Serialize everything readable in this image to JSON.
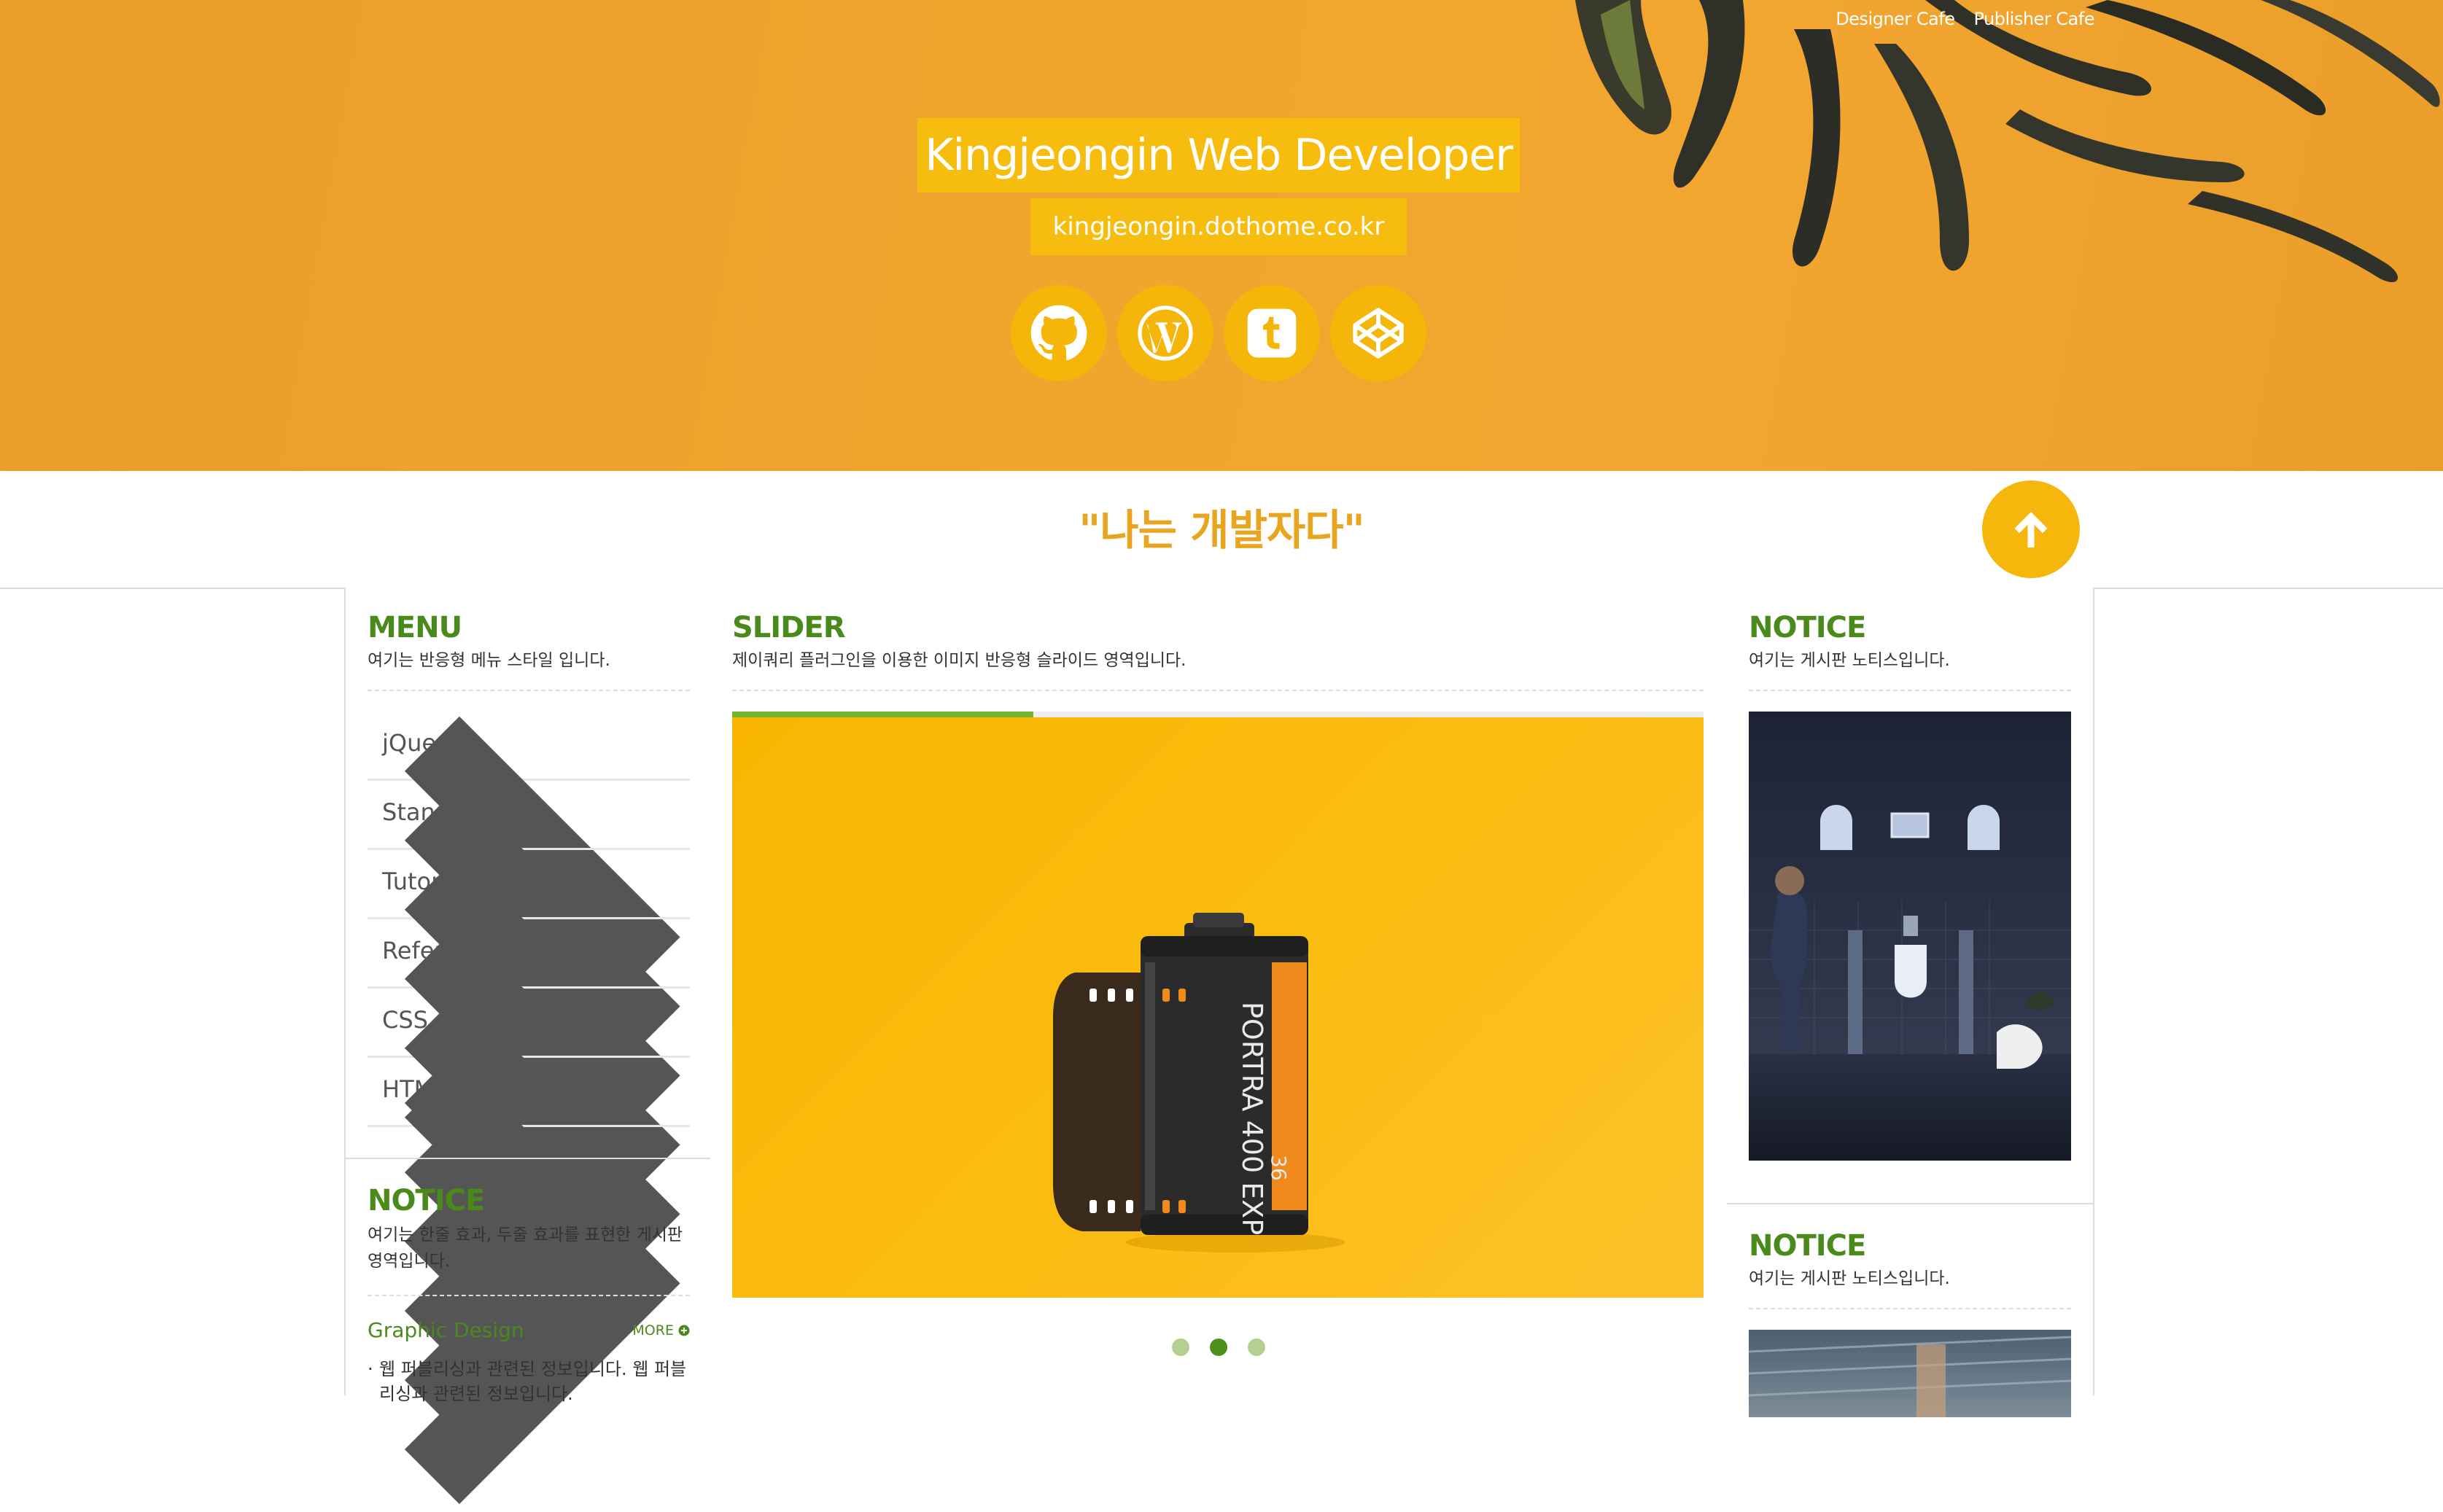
{
  "header": {
    "top_links": [
      "Designer Cafe",
      "Publisher Cafe"
    ],
    "title": "Kingjeongin Web Developer",
    "url": "kingjeongin.dothome.co.kr",
    "social_icons": [
      "github-icon",
      "wordpress-icon",
      "tumblr-icon",
      "codepen-icon"
    ]
  },
  "tagline": "\"나는 개발자다\"",
  "menu": {
    "title": "MENU",
    "desc": "여기는 반응형 메뉴 스타일 입니다.",
    "items": [
      "jQuery",
      "Standard",
      "Tutorial",
      "Reference",
      "CSS",
      "HTML"
    ]
  },
  "notice_left": {
    "title": "NOTICE",
    "desc": "여기는 한줄 효과, 두줄 효과를 표현한 게시판 영역입니다.",
    "item_title": "Graphic Design",
    "more": "MORE",
    "item_text": "웹 퍼블리싱과 관련된 정보입니다. 웹 퍼블리싱과 관련된 정보입니다."
  },
  "slider": {
    "title": "SLIDER",
    "desc": "제이쿼리 플러그인을 이용한 이미지 반응형 슬라이드 영역입니다.",
    "progress": 0.31,
    "dots": 3,
    "active_dot": 1,
    "film_label": "PORTRA 400 EXP",
    "film_count": "36"
  },
  "notice_right_1": {
    "title": "NOTICE",
    "desc": "여기는 게시판 노티스입니다."
  },
  "notice_right_2": {
    "title": "NOTICE",
    "desc": "여기는 게시판 노티스입니다."
  },
  "colors": {
    "header_bg": "#f0a62c",
    "accent_yellow": "#f7bd0e",
    "green": "#4a8a1a",
    "progress_green": "#74b52b"
  }
}
